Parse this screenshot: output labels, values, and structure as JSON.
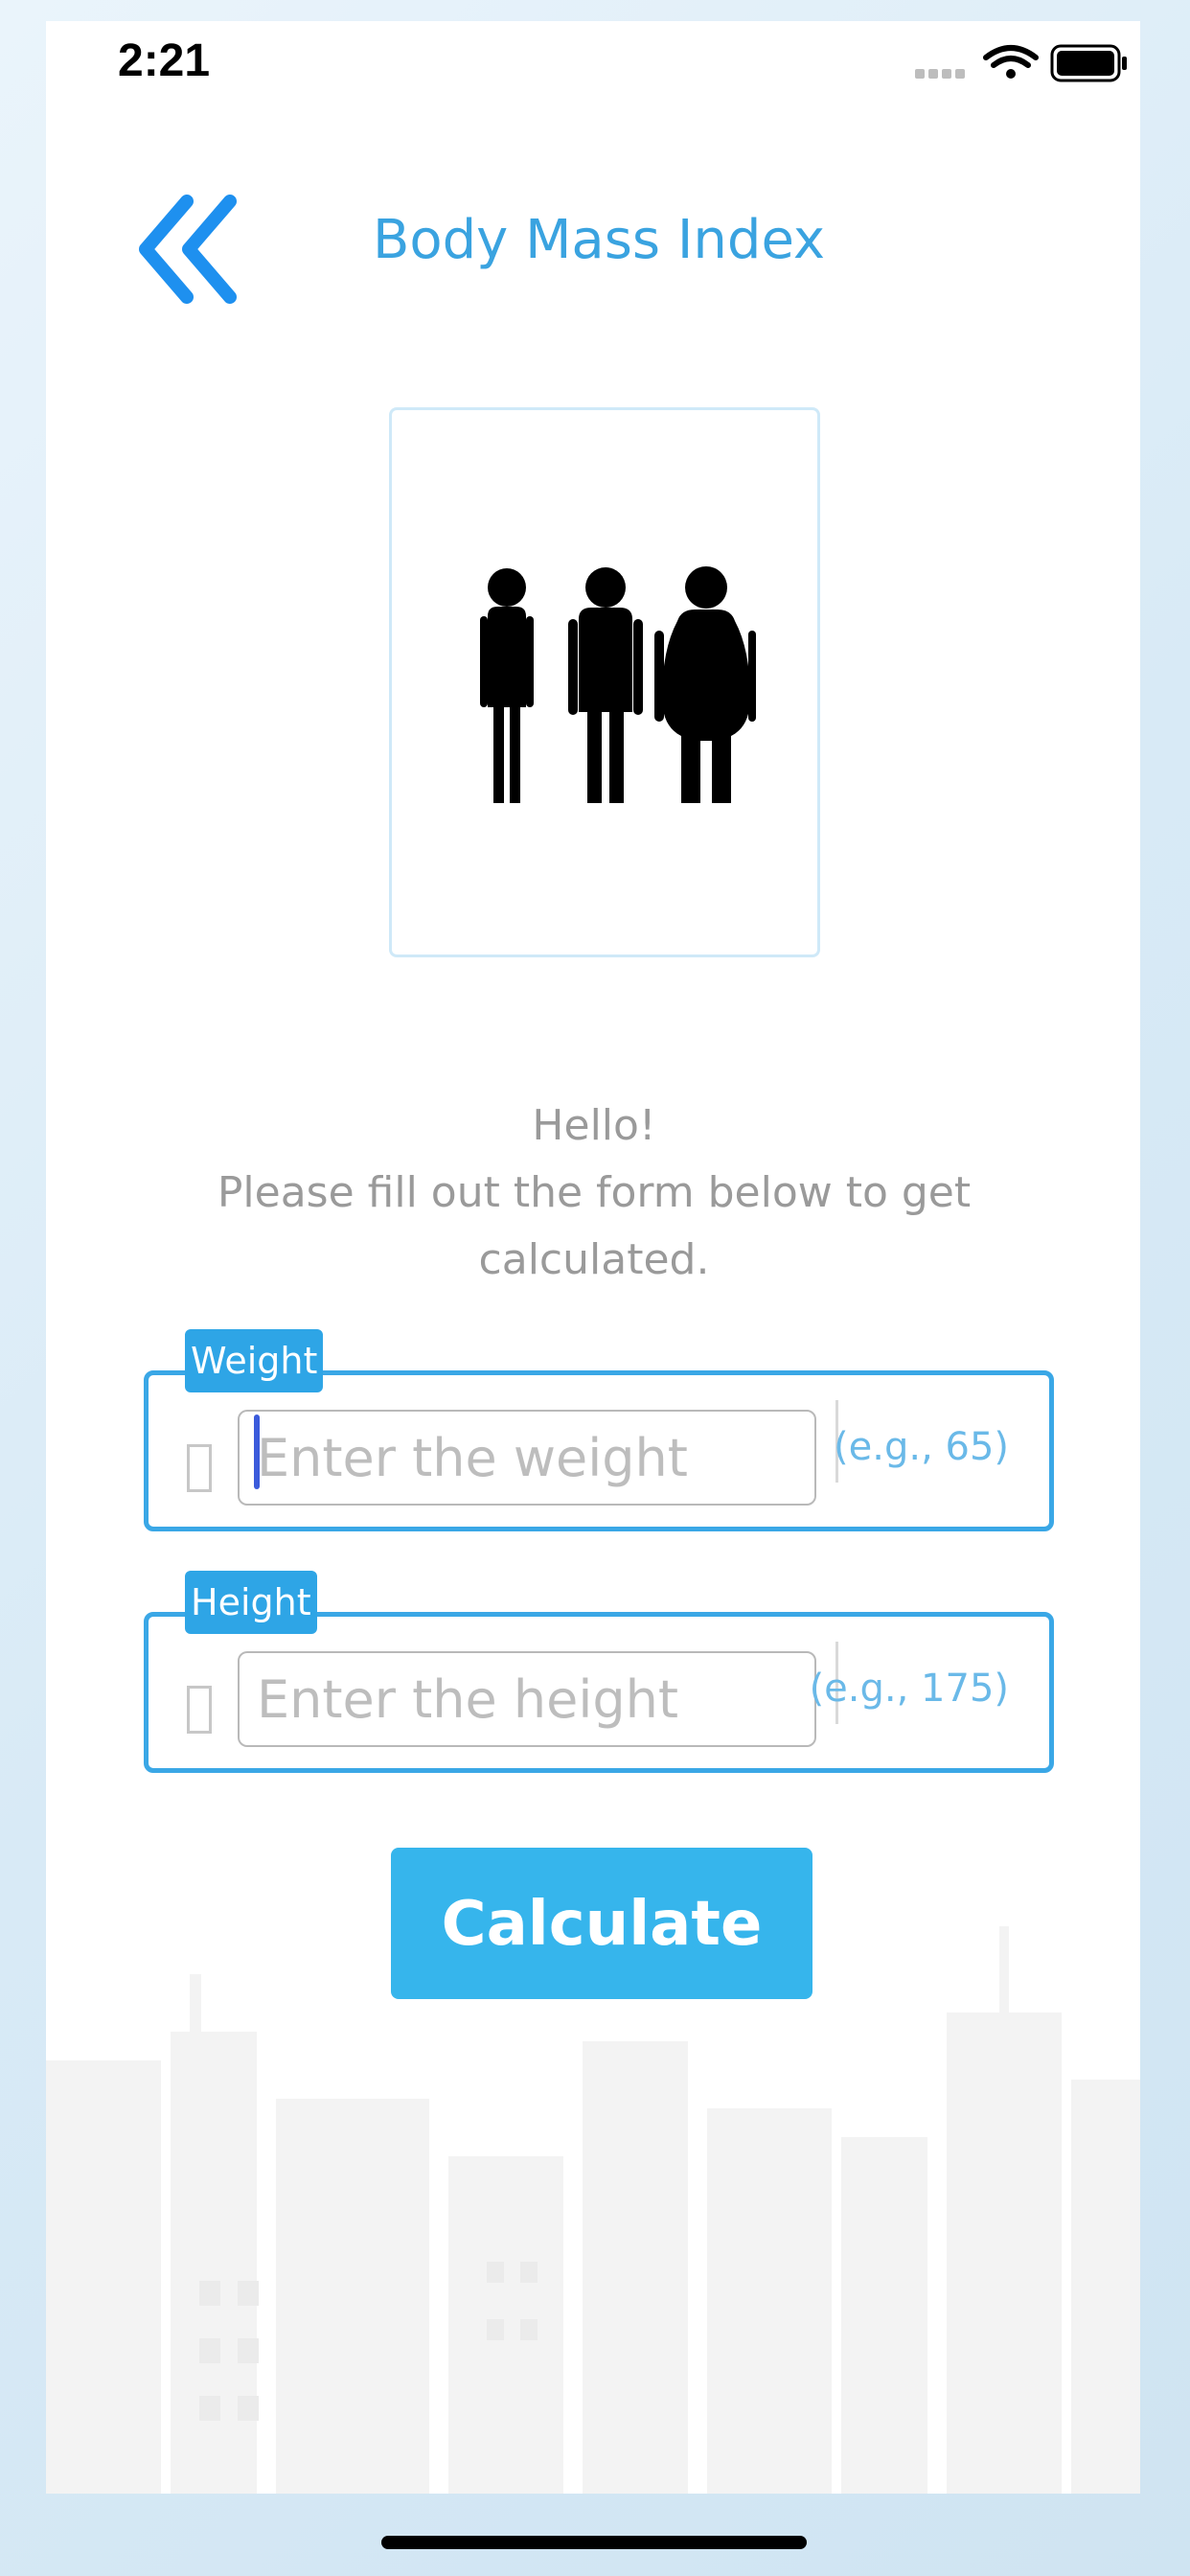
{
  "status_bar": {
    "time": "2:21"
  },
  "header": {
    "title": "Body Mass Index"
  },
  "greeting": {
    "line1": "Hello!",
    "line2": "Please fill out the form below to get calculated."
  },
  "form": {
    "weight": {
      "label": "Weight",
      "placeholder": "Enter the weight",
      "value": "",
      "hint": "(e.g., 65)"
    },
    "height": {
      "label": "Height",
      "placeholder": "Enter the height",
      "value": "",
      "hint": "(e.g., 175)"
    }
  },
  "calculate_label": "Calculate",
  "colors": {
    "accent": "#36b5ec",
    "title": "#3aa3e0",
    "back": "#1e90ef"
  },
  "icons": [
    "back-chevron-icon",
    "signal-icon",
    "wifi-icon",
    "battery-icon",
    "people-icon"
  ]
}
